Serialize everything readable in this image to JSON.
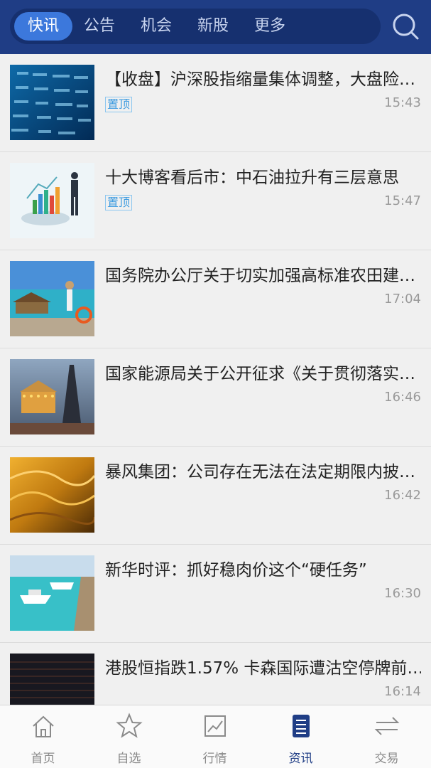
{
  "top_tabs": [
    {
      "label": "快讯",
      "active": true
    },
    {
      "label": "公告",
      "active": false
    },
    {
      "label": "机会",
      "active": false
    },
    {
      "label": "新股",
      "active": false
    },
    {
      "label": "更多",
      "active": false
    }
  ],
  "search_icon": "search-icon",
  "news": [
    {
      "title": "【收盘】沪深股指缩量集体调整，大盘险…",
      "pin": "置顶",
      "time": "15:43",
      "thumb": "stock-board-image"
    },
    {
      "title": "十大博客看后市：中石油拉升有三层意思",
      "pin": "置顶",
      "time": "15:47",
      "thumb": "business-chart-image"
    },
    {
      "title": "国务院办公厅关于切实加强高标准农田建…",
      "pin": "",
      "time": "17:04",
      "thumb": "beach-image"
    },
    {
      "title": "国家能源局关于公开征求《关于贯彻落实…",
      "pin": "",
      "time": "16:46",
      "thumb": "paris-carousel-image"
    },
    {
      "title": "暴风集团：公司存在无法在法定期限内披…",
      "pin": "",
      "time": "16:42",
      "thumb": "desert-image"
    },
    {
      "title": "新华时评：抓好稳肉价这个“硬任务”",
      "pin": "",
      "time": "16:30",
      "thumb": "boats-image"
    },
    {
      "title": "港股恒指跌1.57% 卡森国际遭沽空停牌前…",
      "pin": "",
      "time": "16:14",
      "thumb": "dark-grid-image"
    }
  ],
  "bottom_nav": [
    {
      "label": "首页",
      "icon": "home-icon",
      "active": false
    },
    {
      "label": "自选",
      "icon": "star-icon",
      "active": false
    },
    {
      "label": "行情",
      "icon": "chart-icon",
      "active": false
    },
    {
      "label": "资讯",
      "icon": "news-icon",
      "active": true
    },
    {
      "label": "交易",
      "icon": "exchange-icon",
      "active": false
    }
  ],
  "colors": {
    "header": "#1f3d85",
    "active_tab": "#3c78dc",
    "pin": "#3c9be0"
  }
}
